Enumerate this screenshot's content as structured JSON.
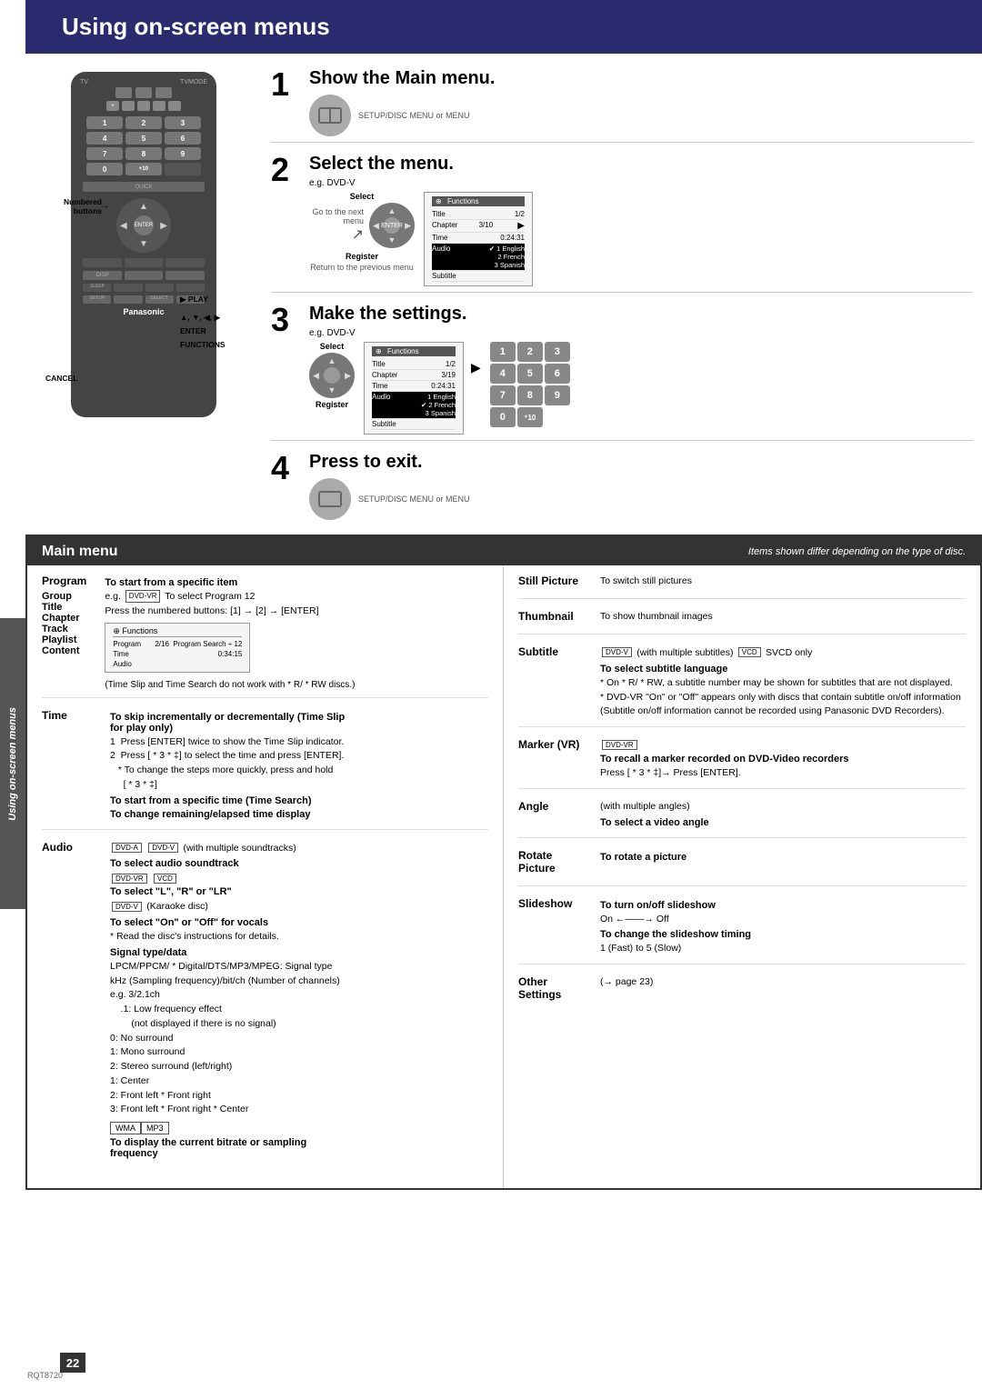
{
  "page": {
    "title": "Using on-screen menus",
    "side_label": "Using on-screen menus",
    "doc_number": "RQT8720",
    "page_number": "22"
  },
  "steps": [
    {
      "number": "1",
      "title": "Show the Main menu."
    },
    {
      "number": "2",
      "title": "Select the menu.",
      "example": "e.g. DVD-V",
      "menu_labels": {
        "select": "Select",
        "go_to_next": "Go to the next menu",
        "register": "Register",
        "return_to_prev": "Return to the previous menu"
      },
      "menu_box": {
        "header": "Functions",
        "rows": [
          {
            "label": "Title",
            "value": "1/2"
          },
          {
            "label": "Chapter",
            "value": "3/10"
          },
          {
            "label": "Time",
            "value": "0:24:31"
          },
          {
            "label": "Audio",
            "value": "1 English"
          },
          {
            "label": "Subtitle",
            "value": ""
          }
        ],
        "options": [
          "✔ 1 English",
          "2 French",
          "3 Spanish"
        ],
        "arrow": "▶"
      }
    },
    {
      "number": "3",
      "title": "Make the settings.",
      "example": "e.g. DVD-V",
      "menu_labels": {
        "select": "Select",
        "register": "Register"
      },
      "menu_box": {
        "header": "Functions",
        "rows": [
          {
            "label": "Title",
            "value": "1/2"
          },
          {
            "label": "Chapter",
            "value": "3/19"
          },
          {
            "label": "Time",
            "value": "0:24:31"
          },
          {
            "label": "Audio",
            "value": "1 English"
          },
          {
            "label": "Subtitle",
            "value": ""
          }
        ],
        "options": [
          "1 English",
          "✔ 2 French",
          "3 Spanish"
        ],
        "highlighted": "2 French"
      },
      "numpad": [
        "1",
        "2",
        "3",
        "4",
        "5",
        "6",
        "7",
        "8",
        "9",
        "0",
        "⁺¹⁰"
      ]
    },
    {
      "number": "4",
      "title": "Press to exit."
    }
  ],
  "remote": {
    "brand": "Panasonic",
    "labels": {
      "numbered_buttons": "Numbered buttons",
      "play": "▶ PLAY",
      "nav": "▲, ▼, ◀, ▶",
      "enter": "ENTER",
      "functions": "FUNCTIONS",
      "cancel": "CANCEL"
    },
    "numpad": [
      "1",
      "2",
      "3",
      "4",
      "5",
      "6",
      "7",
      "8",
      "9",
      "0",
      "⁺¹⁰"
    ]
  },
  "main_menu": {
    "title": "Main menu",
    "note": "Items shown differ depending on the type of disc.",
    "left_items": [
      {
        "title": "Program",
        "subtitle": "To start from a specific item",
        "text": "e.g. DVD-VR To select Program 12\nPress the numbered buttons: [1] → [2] → [ENTER]",
        "has_box": true,
        "box": {
          "title": "Functions",
          "rows": [
            {
              "label": "Program",
              "value": "2/16  Program Search ÷ 12"
            },
            {
              "label": "Time",
              "value": "0:34:15"
            },
            {
              "label": "Audio",
              "value": ""
            }
          ]
        }
      },
      {
        "title": "Group\nTitle\nChapter\nTrack\nPlaylist\nContent",
        "text": ""
      },
      {
        "title": "Time",
        "subtitle": "To skip incrementally or decrementally (Time Slip for play only)",
        "text": "1  Press [ENTER] twice to show the Time Slip indicator.\n2  Press [ * 3 * ‡] to select the time and press [ENTER].\n   * To change the steps more quickly, press and hold  [ * 3 * ‡]\nTo start from a specific time (Time Search)\nTo change remaining/elapsed time display",
        "extra_text": "(Time Slip and Time Search do not work with * R/ * RW discs.)"
      },
      {
        "title": "Audio",
        "subtitle_dvda": "DVD-A  DVD-V (with multiple soundtracks)",
        "sub1": "To select audio soundtrack",
        "subtitle_dvdvr": "DVD-VR  VCD",
        "sub2": "To select \"L\", \"R\" or \"LR\"",
        "subtitle_dvdv": "DVD-V (Karaoke disc)",
        "sub3": "To select \"On\" or \"Off\" for vocals",
        "note": "* Read the disc's instructions for details.",
        "signal": "Signal type/data",
        "signal_text": "LPCM/PPCM/ * Digital/DTS/MP3/MPEG: Signal type\nkHz (Sampling frequency)/bit/ch (Number of channels)",
        "example": "e.g. 3/2.1ch",
        "ch_notes": [
          ".1: Low frequency effect\n     (not displayed if there is no signal)",
          "0: No surround",
          "1: Mono surround",
          "2: Stereo surround (left/right)",
          "1: Center",
          "2: Front left * Front right",
          "3: Front left * Front right * Center"
        ],
        "wma_mp3": "WMA  MP3",
        "wma_note": "To display the current bitrate or sampling frequency"
      }
    ],
    "right_items": [
      {
        "title": "Still Picture",
        "text": "To switch still pictures"
      },
      {
        "title": "Thumbnail",
        "text": "To show thumbnail images"
      },
      {
        "title": "Subtitle",
        "badge1": "DVD-V (with multiple subtitles)",
        "badge2": "VCD",
        "badge3": "SVCD only",
        "sub1": "To select subtitle language",
        "note1": "* On  * R/ * RW, a subtitle number may be shown for subtitles that are not displayed.",
        "note2": "* DVD-VR \"On\" or \"Off\" appears only with discs that contain subtitle on/off information (Subtitle on/off information cannot be recorded using Panasonic DVD Recorders)."
      },
      {
        "title": "Marker (VR)",
        "badge": "DVD-VR",
        "text": "To recall a marker recorded on DVD-Video recorders\nPress [ * 3 * ‡]→ Press [ENTER]."
      },
      {
        "title": "Angle",
        "sub": "(with multiple angles)",
        "text": "To select a video angle"
      },
      {
        "title": "Rotate Picture",
        "text": "To rotate a picture"
      },
      {
        "title": "Slideshow",
        "text1": "To turn on/off slideshow",
        "on_off": "On ←——→ Off",
        "text2": "To change the slideshow timing\n1 (Fast) to 5 (Slow)"
      },
      {
        "title": "Other Settings",
        "text": "(→ page 23)"
      }
    ]
  }
}
